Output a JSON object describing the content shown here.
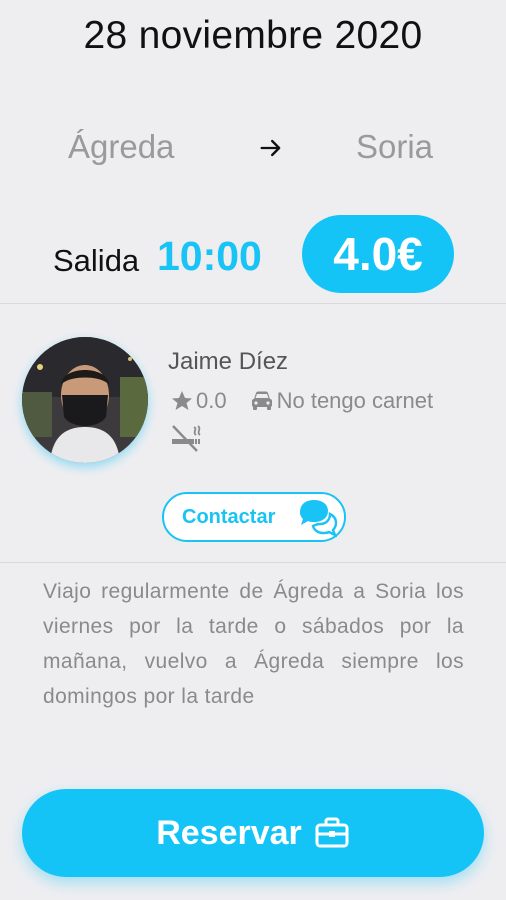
{
  "trip": {
    "date": "28 noviembre 2020",
    "origin": "Ágreda",
    "destination": "Soria",
    "departure_label": "Salida",
    "departure_time": "10:00",
    "price": "4.0€"
  },
  "driver": {
    "name": "Jaime Díez",
    "rating": "0.0",
    "license_status": "No tengo carnet",
    "smoking_icon": "no-smoking-icon"
  },
  "actions": {
    "contact_label": "Contactar",
    "reserve_label": "Reservar"
  },
  "description": "Viajo regularmente de Ágreda a Soria los viernes por la tarde o sábados por la mañana, vuelvo a Ágreda siempre los domingos por la tarde",
  "colors": {
    "accent": "#15c4f7",
    "background": "#eeeef1",
    "muted_text": "#8a8a8a"
  }
}
